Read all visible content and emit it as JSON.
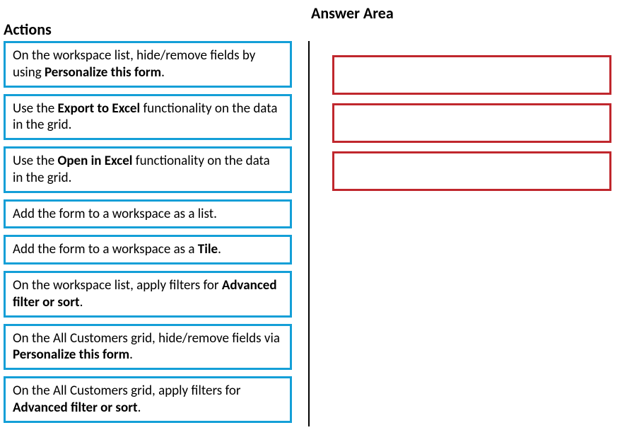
{
  "titles": {
    "answer_area": "Answer Area",
    "actions": "Actions"
  },
  "actions": [
    {
      "pre": "On the workspace list, hide/remove fields by using ",
      "bold": "Personalize this form",
      "post": "."
    },
    {
      "pre": "Use the ",
      "bold": "Export to Excel",
      "post": " functionality on the data in the grid."
    },
    {
      "pre": "Use the ",
      "bold": "Open in Excel",
      "post": " functionality on the data in the grid."
    },
    {
      "pre": "Add the form to a workspace as a list.",
      "bold": "",
      "post": ""
    },
    {
      "pre": "Add the form to a workspace as a ",
      "bold": "Tile",
      "post": "."
    },
    {
      "pre": "On the workspace list, apply filters for ",
      "bold": "Advanced filter or sort",
      "post": "."
    },
    {
      "pre": "On the All Customers grid, hide/remove fields via ",
      "bold": "Personalize this form",
      "post": "."
    },
    {
      "pre": "On the All Customers grid, apply filters for ",
      "bold": "Advanced filter or sort",
      "post": "."
    }
  ],
  "answer_slots_count": 3
}
